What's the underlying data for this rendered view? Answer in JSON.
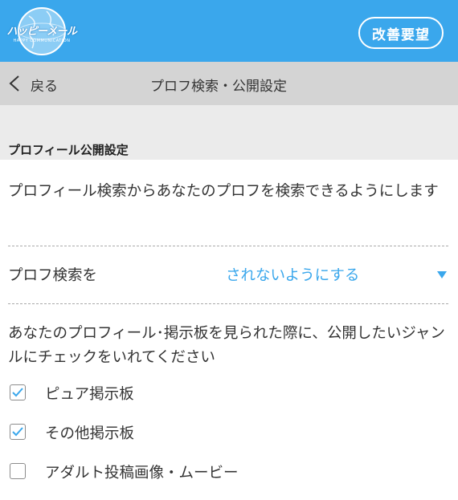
{
  "header": {
    "logo_text": "ハッピーメール",
    "logo_subtext": "HAPPY COMMUNICATION",
    "kaizen_label": "改善要望"
  },
  "nav": {
    "back_label": "戻る",
    "title": "プロフ検索・公開設定"
  },
  "section": {
    "title": "プロフィール公開設定"
  },
  "search_setting": {
    "description": "プロフィール検索からあなたのプロフを検索できるようにします",
    "label": "プロフ検索を",
    "selected_value": "されないようにする"
  },
  "genres": {
    "description": "あなたのプロフィール･掲示板を見られた際に、公開したいジャンルにチェックをいれてください",
    "items": [
      {
        "label": "ピュア掲示板",
        "checked": true
      },
      {
        "label": "その他掲示板",
        "checked": true
      },
      {
        "label": "アダルト投稿画像・ムービー",
        "checked": false
      }
    ]
  },
  "colors": {
    "header_bg": "#3aa7ec",
    "navbar_bg": "#d4d4d4",
    "section_bg": "#ebebeb",
    "accent": "#3aa7ec"
  }
}
